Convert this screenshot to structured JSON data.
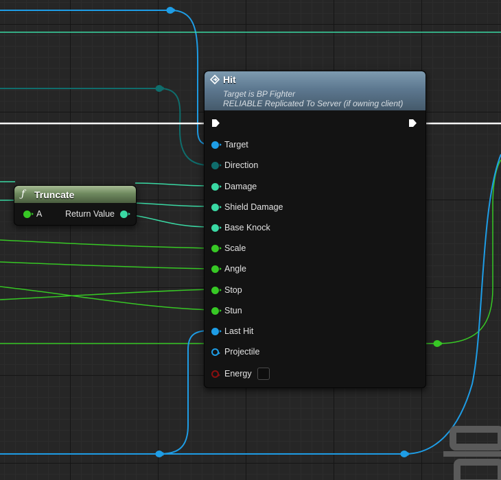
{
  "hit_node": {
    "title": "Hit",
    "subtitle_target": "Target is BP Fighter",
    "subtitle_replication": "RELIABLE Replicated To Server (if owning client)",
    "header_color": "#5d7890",
    "icon": "function-diamond-icon",
    "pins": [
      {
        "name": "pin-target",
        "label": "Target",
        "type": "object",
        "color": "#1e9de6"
      },
      {
        "name": "pin-direction",
        "label": "Direction",
        "type": "vector",
        "color": "#0f6d6c"
      },
      {
        "name": "pin-damage",
        "label": "Damage",
        "type": "float",
        "color": "#3ad9a4"
      },
      {
        "name": "pin-shield-damage",
        "label": "Shield Damage",
        "type": "float",
        "color": "#3ad9a4"
      },
      {
        "name": "pin-base-knock",
        "label": "Base Knock",
        "type": "float",
        "color": "#3ad9a4"
      },
      {
        "name": "pin-scale",
        "label": "Scale",
        "type": "integer",
        "color": "#37c825"
      },
      {
        "name": "pin-angle",
        "label": "Angle",
        "type": "integer",
        "color": "#37c825"
      },
      {
        "name": "pin-stop",
        "label": "Stop",
        "type": "integer",
        "color": "#37c825"
      },
      {
        "name": "pin-stun",
        "label": "Stun",
        "type": "integer",
        "color": "#37c825"
      },
      {
        "name": "pin-last-hit",
        "label": "Last Hit",
        "type": "object",
        "color": "#1e9de6"
      },
      {
        "name": "pin-projectile",
        "label": "Projectile",
        "type": "object-unconnected",
        "color": "#1e9de6"
      },
      {
        "name": "pin-energy",
        "label": "Energy",
        "type": "boolean-unconnected",
        "color": "#8a0f0f"
      }
    ]
  },
  "truncate_node": {
    "title": "Truncate",
    "icon": "function-f-icon",
    "header_color": "#6f8a5f",
    "input_label": "A",
    "output_label": "Return Value"
  },
  "colors": {
    "background": "#262626",
    "exec_wire": "#ffffff",
    "object_wire": "#1e9de6",
    "vector_wire": "#0f6d6c",
    "float_wire": "#3ad9a4",
    "integer_wire": "#37c825"
  }
}
